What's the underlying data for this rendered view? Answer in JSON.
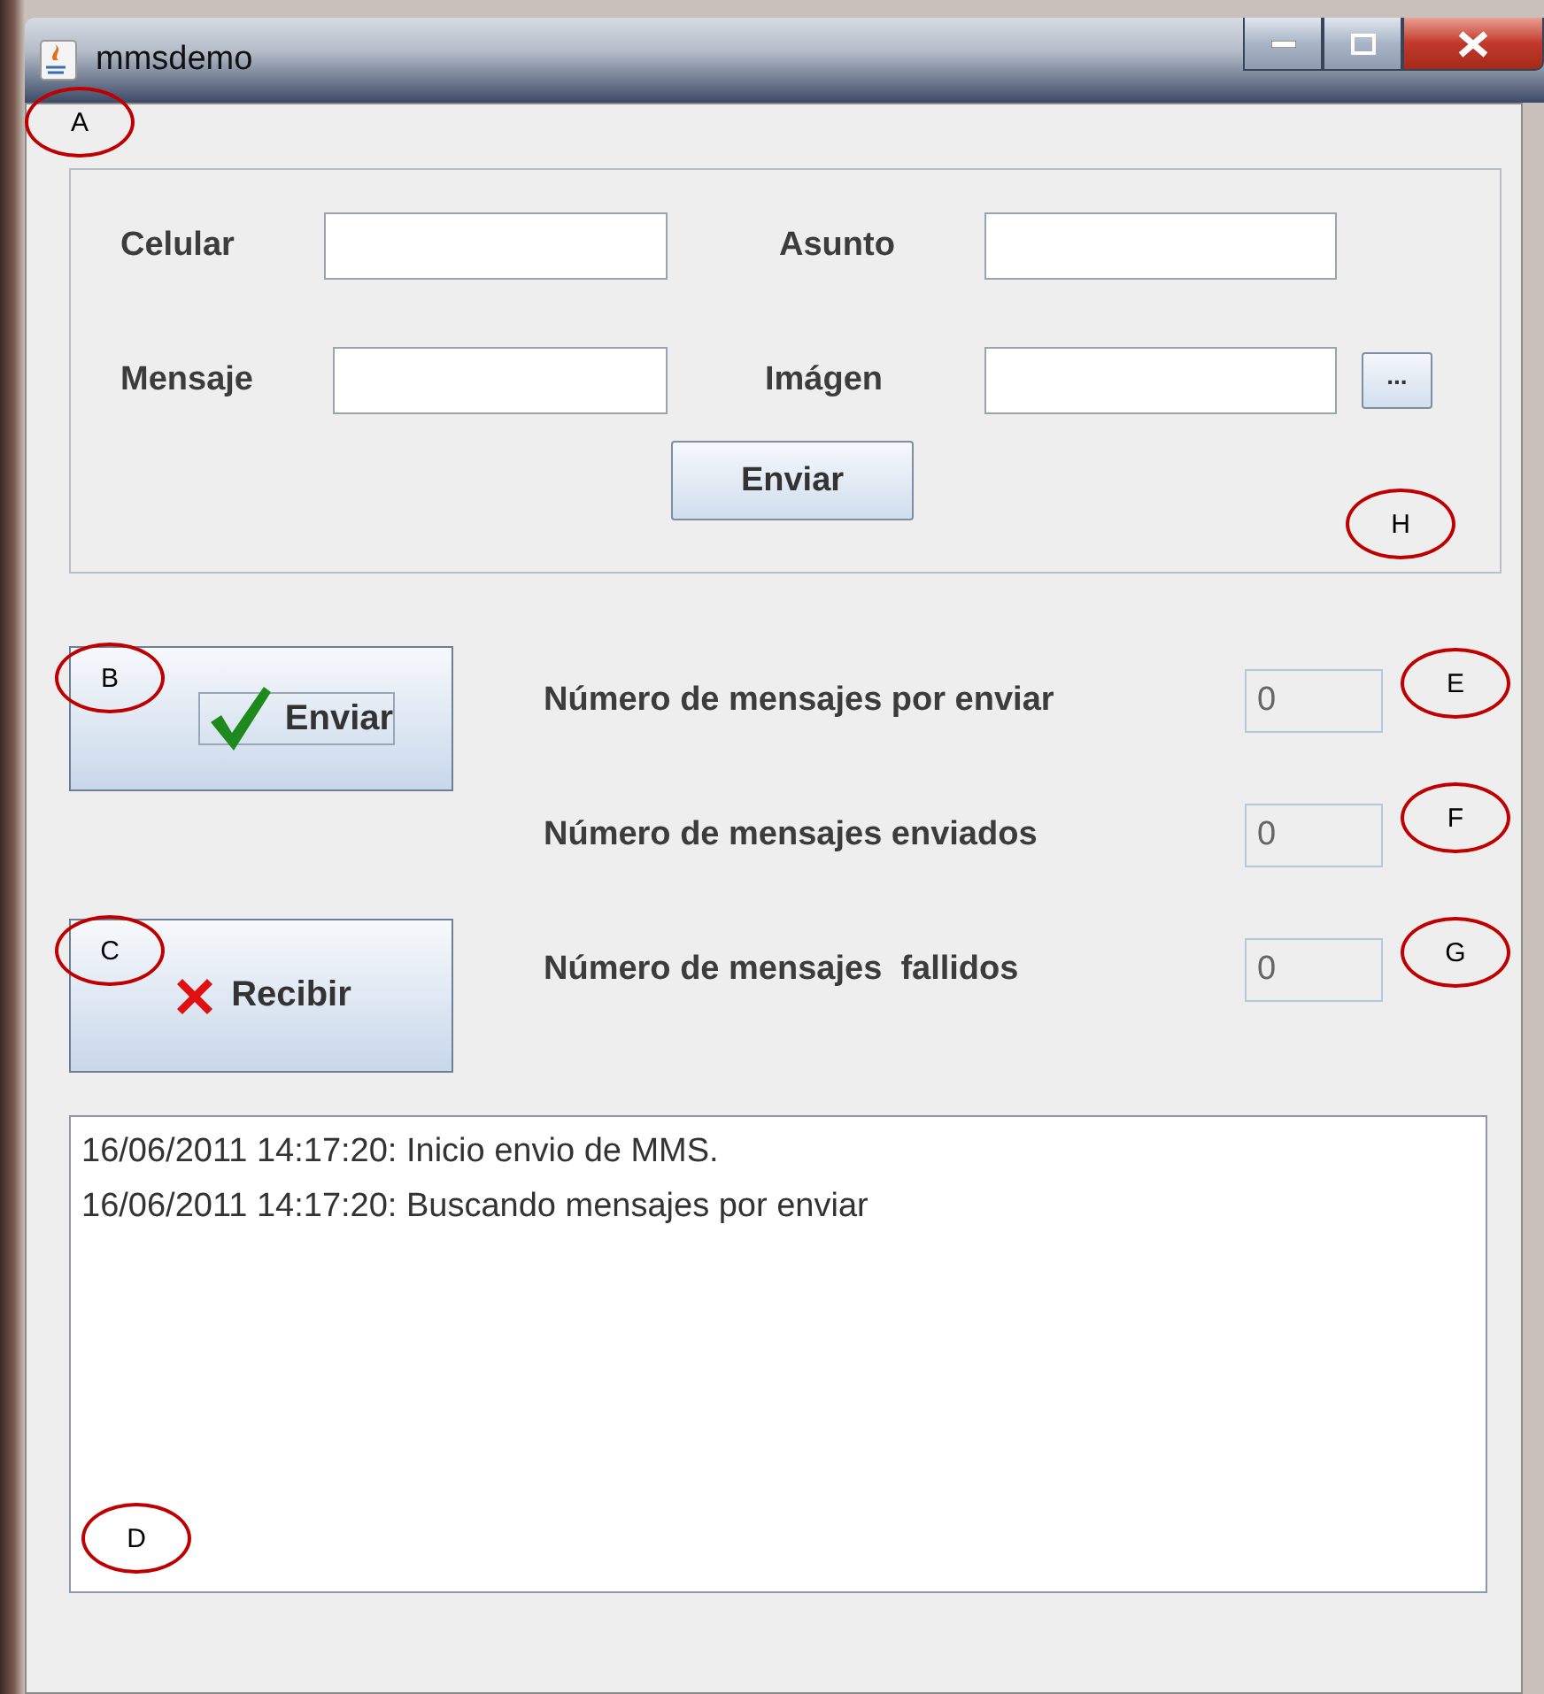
{
  "window": {
    "title": "mmsdemo"
  },
  "form": {
    "marker": "A",
    "corner_marker": "H",
    "fields": [
      {
        "label": "Celular"
      },
      {
        "label": "Asunto"
      },
      {
        "label": "Mensaje"
      },
      {
        "label": "Imágen"
      }
    ],
    "browse_button": "...",
    "send_button": "Enviar"
  },
  "actions": [
    {
      "kind": "check",
      "label": "Enviar",
      "marker": "B",
      "focused": true
    },
    {
      "kind": "cross",
      "label": "Recibir",
      "marker": "C",
      "focused": false
    }
  ],
  "counters": [
    {
      "label": "Número de mensajes por enviar",
      "value": "0",
      "marker": "E"
    },
    {
      "label": "Número de mensajes enviados",
      "value": "0",
      "marker": "F"
    },
    {
      "label": "Número de mensajes  fallidos",
      "value": "0",
      "marker": "G"
    }
  ],
  "log": {
    "lines": [
      "16/06/2011 14:17:20: Inicio envio de MMS.",
      "16/06/2011 14:17:20: Buscando mensajes por enviar"
    ],
    "marker": "D"
  }
}
